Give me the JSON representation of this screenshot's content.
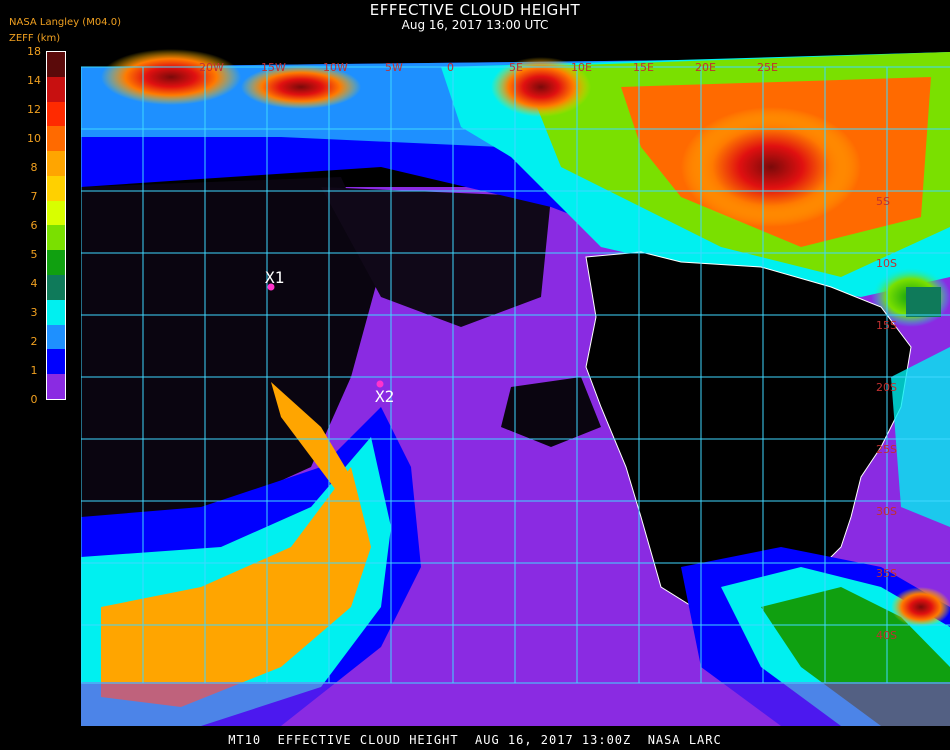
{
  "title": "EFFECTIVE CLOUD HEIGHT",
  "subtitle": "Aug 16, 2017 13:00 UTC",
  "source_label": "NASA Langley (M04.0)",
  "variable_label": "ZEFF (km)",
  "colorbar": {
    "ticks": [
      "18",
      "14",
      "12",
      "10",
      "8",
      "7",
      "6",
      "5",
      "4",
      "3",
      "2",
      "1",
      "0"
    ],
    "colors": [
      "#5a0a0a",
      "#c81010",
      "#ff2a00",
      "#ff6a00",
      "#ffa500",
      "#ffd000",
      "#d8ff00",
      "#7ae000",
      "#10a010",
      "#0f7a5a",
      "#00f0f0",
      "#1e90ff",
      "#0000ff",
      "#8a2be2"
    ]
  },
  "map": {
    "lat_labels": [
      "5S",
      "10S",
      "15S",
      "20S",
      "25S",
      "30S",
      "35S",
      "40S"
    ],
    "lon_labels": [
      "20W",
      "15W",
      "10W",
      "5W",
      "0",
      "5E",
      "10E",
      "15E",
      "20E",
      "25E"
    ],
    "markers": [
      {
        "label": "X1",
        "color": "#ff33cc"
      },
      {
        "label": "X2",
        "color": "#ff33cc"
      }
    ],
    "colors": {
      "grid": "#3fd8ff",
      "coast": "#ffffff",
      "land": "#000000"
    }
  },
  "footer": "MT10  EFFECTIVE CLOUD HEIGHT  AUG 16, 2017 13:00Z  NASA LARC"
}
